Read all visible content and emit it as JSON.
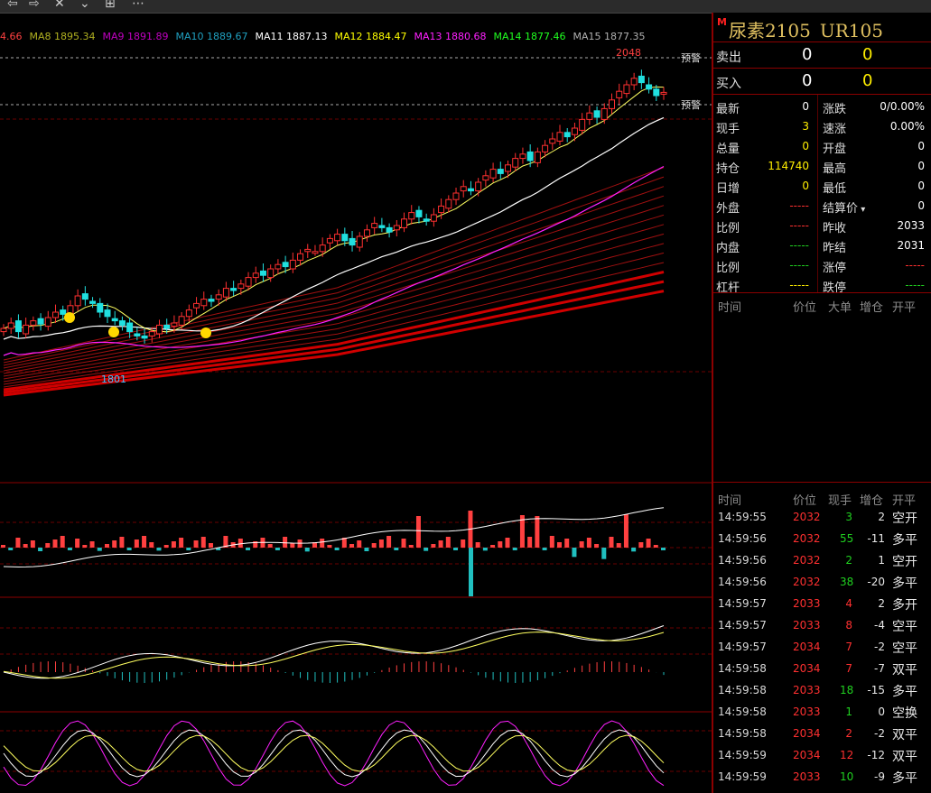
{
  "toolbar": {
    "icons": [
      "back-arrow-icon",
      "forward-arrow-icon",
      "close-icon",
      "chevron-down-icon",
      "layout-icon",
      "more-icon"
    ]
  },
  "ma_legend": [
    {
      "label": "4.66",
      "color": "#ff4040"
    },
    {
      "label": "MA8 1895.34",
      "color": "#b0b020"
    },
    {
      "label": "MA9 1891.89",
      "color": "#c000c0"
    },
    {
      "label": "MA10 1889.67",
      "color": "#20a0c0"
    },
    {
      "label": "MA11 1887.13",
      "color": "#ffffff"
    },
    {
      "label": "MA12 1884.47",
      "color": "#ffff00"
    },
    {
      "label": "MA13 1880.68",
      "color": "#ff20ff"
    },
    {
      "label": "MA14 1877.46",
      "color": "#20ff20"
    },
    {
      "label": "MA15 1877.35",
      "color": "#b0b0b0"
    }
  ],
  "chart": {
    "high_label": "2048",
    "low_label": "1801",
    "alert_label": "预警",
    "alert_label_2": "预警"
  },
  "quote": {
    "m_badge": "M",
    "name": "尿素2105",
    "code": "UR105",
    "sell_label": "卖出",
    "sell_price": "0",
    "sell_vol": "0",
    "buy_label": "买入",
    "buy_price": "0",
    "buy_vol": "0",
    "left_stats": [
      {
        "k": "最新",
        "v": "0",
        "color": "#ffffff"
      },
      {
        "k": "现手",
        "v": "3",
        "color": "#ffee00"
      },
      {
        "k": "总量",
        "v": "0",
        "color": "#ffee00"
      },
      {
        "k": "持仓",
        "v": "114740",
        "color": "#ffee00"
      },
      {
        "k": "日增",
        "v": "0",
        "color": "#ffee00"
      },
      {
        "k": "外盘",
        "v": "-----",
        "color": "#ff3030"
      },
      {
        "k": "比例",
        "v": "-----",
        "color": "#ff3030"
      },
      {
        "k": "内盘",
        "v": "-----",
        "color": "#20d020"
      },
      {
        "k": "比例",
        "v": "-----",
        "color": "#20d020"
      },
      {
        "k": "杠杆",
        "v": "-----",
        "color": "#ffee00"
      }
    ],
    "right_stats": [
      {
        "k": "涨跌",
        "v": "0/0.00%",
        "color": "#ffffff"
      },
      {
        "k": "速涨",
        "v": "0.00%",
        "color": "#ffffff"
      },
      {
        "k": "开盘",
        "v": "0",
        "color": "#ffffff"
      },
      {
        "k": "最高",
        "v": "0",
        "color": "#ffffff"
      },
      {
        "k": "最低",
        "v": "0",
        "color": "#ffffff"
      },
      {
        "k": "结算价",
        "v": "0",
        "color": "#ffffff"
      },
      {
        "k": "昨收",
        "v": "2033",
        "color": "#ffffff"
      },
      {
        "k": "昨结",
        "v": "2031",
        "color": "#ffffff"
      },
      {
        "k": "涨停",
        "v": "-----",
        "color": "#ff3030"
      },
      {
        "k": "跌停",
        "v": "-----",
        "color": "#20d020"
      }
    ]
  },
  "big_order_header": {
    "time": "时间",
    "price": "价位",
    "big": "大单",
    "oi": "增仓",
    "type": "开平"
  },
  "tape_header": {
    "time": "时间",
    "price": "价位",
    "vol": "现手",
    "oi": "增仓",
    "type": "开平"
  },
  "tape": [
    {
      "time": "14:59:55",
      "price": "2032",
      "vol": "3",
      "oi": "2",
      "type": "空开",
      "vol_color": "#20d020"
    },
    {
      "time": "14:59:56",
      "price": "2032",
      "vol": "55",
      "oi": "-11",
      "type": "多平",
      "vol_color": "#20d020"
    },
    {
      "time": "14:59:56",
      "price": "2032",
      "vol": "2",
      "oi": "1",
      "type": "空开",
      "vol_color": "#20d020"
    },
    {
      "time": "14:59:56",
      "price": "2032",
      "vol": "38",
      "oi": "-20",
      "type": "多平",
      "vol_color": "#20d020"
    },
    {
      "time": "14:59:57",
      "price": "2033",
      "vol": "4",
      "oi": "2",
      "type": "多开",
      "vol_color": "#ff3030"
    },
    {
      "time": "14:59:57",
      "price": "2033",
      "vol": "8",
      "oi": "-4",
      "type": "空平",
      "vol_color": "#ff3030"
    },
    {
      "time": "14:59:57",
      "price": "2034",
      "vol": "7",
      "oi": "-2",
      "type": "空平",
      "vol_color": "#ff3030"
    },
    {
      "time": "14:59:58",
      "price": "2034",
      "vol": "7",
      "oi": "-7",
      "type": "双平",
      "vol_color": "#ff3030"
    },
    {
      "time": "14:59:58",
      "price": "2033",
      "vol": "18",
      "oi": "-15",
      "type": "多平",
      "vol_color": "#20d020"
    },
    {
      "time": "14:59:58",
      "price": "2033",
      "vol": "1",
      "oi": "0",
      "type": "空换",
      "vol_color": "#20d020"
    },
    {
      "time": "14:59:58",
      "price": "2034",
      "vol": "2",
      "oi": "-2",
      "type": "双平",
      "vol_color": "#ff3030"
    },
    {
      "time": "14:59:59",
      "price": "2034",
      "vol": "12",
      "oi": "-12",
      "type": "双平",
      "vol_color": "#ff3030"
    },
    {
      "time": "14:59:59",
      "price": "2033",
      "vol": "10",
      "oi": "-9",
      "type": "多平",
      "vol_color": "#20d020"
    }
  ],
  "chart_data": {
    "type": "candlestick",
    "symbol": "UR105",
    "annotations": {
      "high": 2048,
      "low": 1801
    },
    "y_estimated_range": [
      1760,
      2060
    ],
    "closes_estimated": [
      1815,
      1820,
      1812,
      1818,
      1822,
      1819,
      1825,
      1830,
      1828,
      1836,
      1845,
      1842,
      1838,
      1830,
      1826,
      1822,
      1818,
      1812,
      1808,
      1806,
      1812,
      1818,
      1815,
      1820,
      1826,
      1832,
      1838,
      1842,
      1840,
      1846,
      1852,
      1850,
      1856,
      1862,
      1866,
      1864,
      1870,
      1874,
      1872,
      1878,
      1884,
      1888,
      1886,
      1892,
      1898,
      1902,
      1896,
      1892,
      1900,
      1906,
      1912,
      1908,
      1904,
      1910,
      1916,
      1922,
      1918,
      1914,
      1920,
      1928,
      1934,
      1940,
      1946,
      1942,
      1950,
      1956,
      1962,
      1958,
      1966,
      1972,
      1976,
      1970,
      1978,
      1984,
      1990,
      1996,
      1992,
      2000,
      2008,
      2014,
      2010,
      2018,
      2026,
      2034,
      2040,
      2046,
      2042,
      2036,
      2030,
      2033
    ],
    "ma_values": {
      "MA8": 1895.34,
      "MA9": 1891.89,
      "MA10": 1889.67,
      "MA11": 1887.13,
      "MA12": 1884.47,
      "MA13": 1880.68,
      "MA14": 1877.46,
      "MA15": 1877.35
    }
  }
}
